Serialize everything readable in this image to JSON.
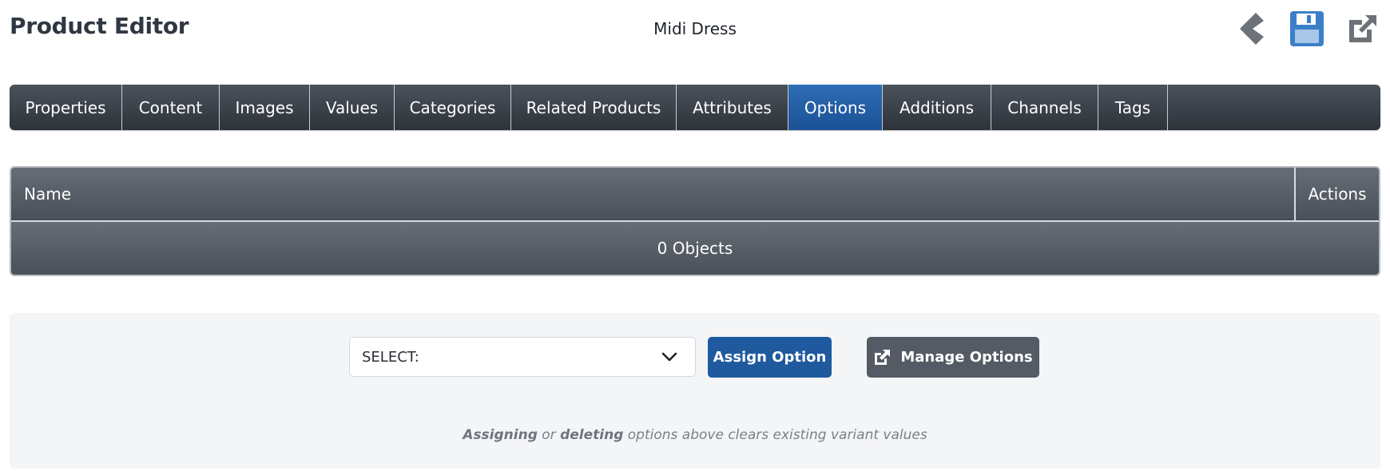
{
  "header": {
    "title": "Product Editor",
    "product_name": "Midi Dress",
    "icons": [
      "chevron-left-icon",
      "save-icon",
      "external-link-icon"
    ]
  },
  "tabs": [
    {
      "label": "Properties",
      "active": false
    },
    {
      "label": "Content",
      "active": false
    },
    {
      "label": "Images",
      "active": false
    },
    {
      "label": "Values",
      "active": false
    },
    {
      "label": "Categories",
      "active": false
    },
    {
      "label": "Related Products",
      "active": false
    },
    {
      "label": "Attributes",
      "active": false
    },
    {
      "label": "Options",
      "active": true
    },
    {
      "label": "Additions",
      "active": false
    },
    {
      "label": "Channels",
      "active": false
    },
    {
      "label": "Tags",
      "active": false
    }
  ],
  "grid": {
    "columns": [
      "Name",
      "Actions"
    ],
    "rows": [],
    "footer": "0 Objects"
  },
  "assign_panel": {
    "select_value": "SELECT:",
    "assign_label": "Assign Option",
    "manage_label": "Manage Options",
    "hint_part1": "Assigning",
    "hint_part2": " or ",
    "hint_part3": "deleting",
    "hint_part4": " options above clears existing variant values"
  },
  "colors": {
    "accent": "#1f5a9e",
    "save_icon": "#3b7fc9",
    "icon_gray": "#6c7278",
    "tab_bar": "#2e333a"
  }
}
